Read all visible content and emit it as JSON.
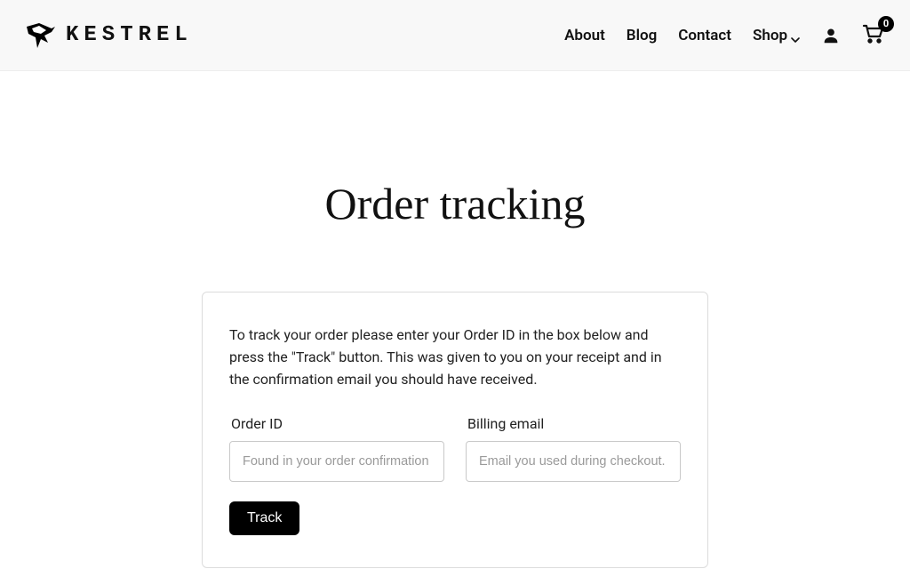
{
  "brand": {
    "name": "KESTREL"
  },
  "nav": {
    "about": "About",
    "blog": "Blog",
    "contact": "Contact",
    "shop": "Shop",
    "cart_count": "0"
  },
  "page": {
    "title": "Order tracking",
    "description": "To track your order please enter your Order ID in the box below and press the \"Track\" button. This was given to you on your receipt and in the confirmation email you should have received."
  },
  "form": {
    "order_id": {
      "label": "Order ID",
      "placeholder": "Found in your order confirmation email."
    },
    "billing_email": {
      "label": "Billing email",
      "placeholder": "Email you used during checkout."
    },
    "submit": "Track"
  }
}
